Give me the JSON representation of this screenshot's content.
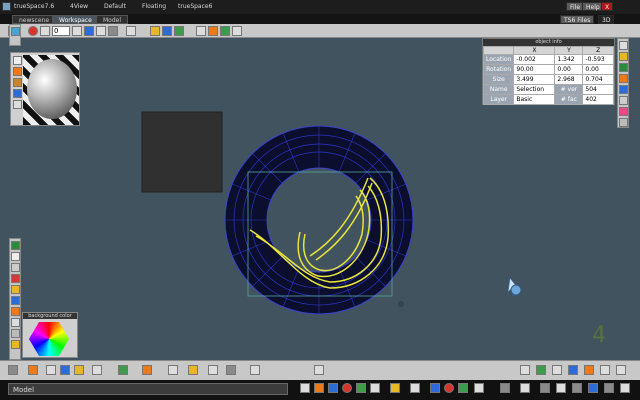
{
  "titlebar": {
    "app_name": "trueSpace7.6",
    "view_label": "4View",
    "default_label": "Default",
    "floating_label": "Floating",
    "workspace_label": "trueSpace6",
    "file_label": "File",
    "help_label": "Help",
    "close_label": "X",
    "ts6_files_label": "TS6 Files",
    "mode_label": "3D"
  },
  "tabs": [
    {
      "label": "newscene"
    },
    {
      "label": "Workspace"
    },
    {
      "label": "Model"
    }
  ],
  "toolbar": {
    "frame_value": "0"
  },
  "object_info": {
    "title": "object info",
    "columns": [
      "X",
      "Y",
      "Z"
    ],
    "rows": [
      {
        "label": "Location",
        "x": "-0.002",
        "y": "1.342",
        "z": "-0.593"
      },
      {
        "label": "Rotation",
        "x": "90.00",
        "y": "0.00",
        "z": "0.00"
      },
      {
        "label": "Size",
        "x": "3.499",
        "y": "2.968",
        "z": "0.704"
      }
    ],
    "name_label": "Name",
    "name_value": "Selection",
    "vert_label": "# ver",
    "vert_value": "504",
    "layer_label": "Layer",
    "layer_value": "Basic",
    "fac_label": "# fac",
    "fac_value": "402"
  },
  "background_color_panel": {
    "title": "background color"
  },
  "statusbar": {
    "label": "Model"
  },
  "colors": {
    "viewport_bg": "#41535f",
    "selection_yellow": "#e7e43b",
    "mesh_blue": "#2d35c8"
  }
}
